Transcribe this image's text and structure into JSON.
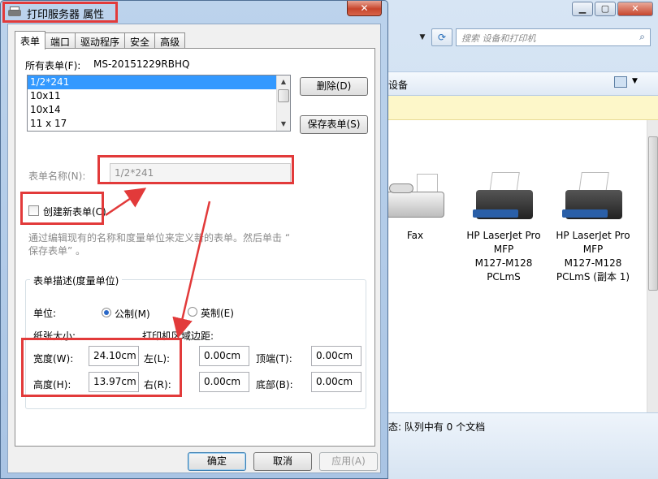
{
  "dialog": {
    "title": "打印服务器 属性",
    "close_label": "✕",
    "tabs": [
      "表单",
      "端口",
      "驱动程序",
      "安全",
      "高级"
    ],
    "all_forms_label": "所有表单(F):",
    "server_name": "MS-20151229RBHQ",
    "forms": [
      "1/2*241",
      "10x11",
      "10x14",
      "11 x 17"
    ],
    "delete_button": "删除(D)",
    "save_button": "保存表单(S)",
    "form_name_label": "表单名称(N):",
    "form_name_value": "1/2*241",
    "create_new_label": "创建新表单(C)",
    "description_line1": "通过编辑现有的名称和度量单位来定义新的表单。然后单击 “",
    "description_line2": "保存表单” 。",
    "group_title": "表单描述(度量单位)",
    "unit_label": "单位:",
    "metric_label": "公制(M)",
    "english_label": "英制(E)",
    "paper_size_label": "纸张大小:",
    "margins_label": "打印机区域边距:",
    "width_label": "宽度(W):",
    "width_value": "24.10cm",
    "height_label": "高度(H):",
    "height_value": "13.97cm",
    "left_label": "左(L):",
    "left_value": "0.00cm",
    "right_label": "右(R):",
    "right_value": "0.00cm",
    "top_label": "顶端(T):",
    "top_value": "0.00cm",
    "bottom_label": "底部(B):",
    "bottom_value": "0.00cm",
    "ok_button": "确定",
    "cancel_button": "取消",
    "apply_button": "应用(A)"
  },
  "explorer": {
    "search_placeholder": "搜索 设备和打印机",
    "toolbar_text": "设备",
    "devices": [
      {
        "name_lines": [
          "Fax"
        ]
      },
      {
        "name_lines": [
          "HP LaserJet Pro",
          "MFP",
          "M127-M128",
          "PCLmS"
        ]
      },
      {
        "name_lines": [
          "HP LaserJet Pro",
          "MFP",
          "M127-M128",
          "PCLmS (副本 1)"
        ]
      }
    ],
    "status_text": "态: 队列中有 0 个文档"
  }
}
